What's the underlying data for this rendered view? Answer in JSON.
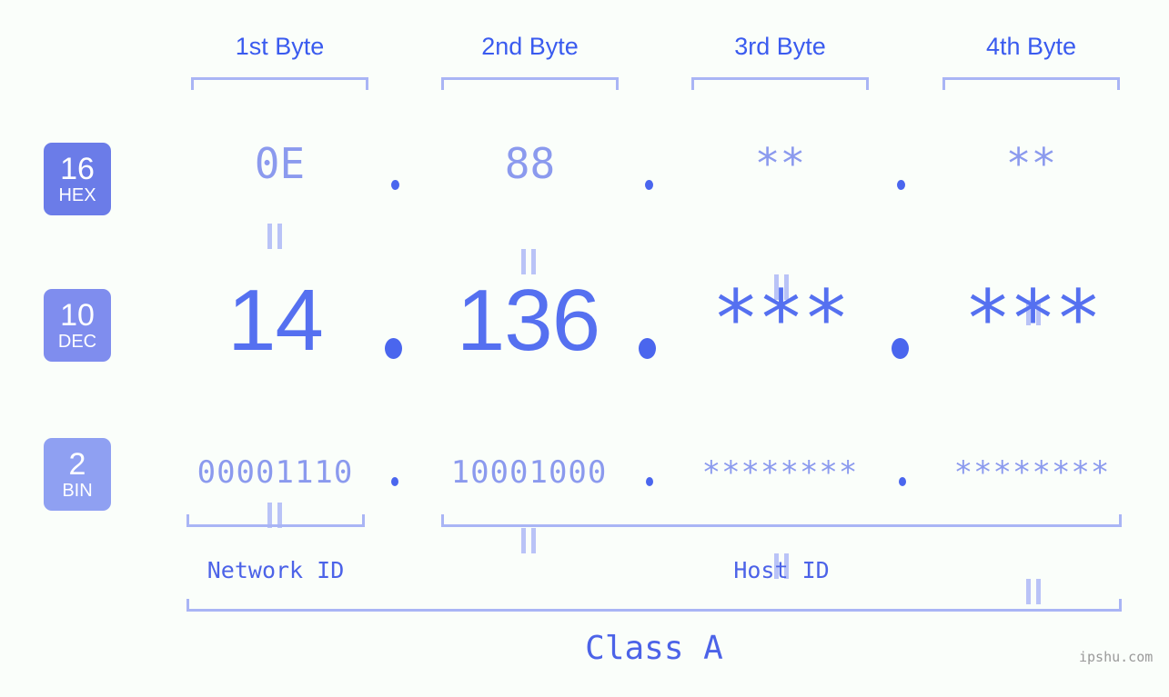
{
  "page": {
    "background": "#FAFEFA",
    "watermark": "ipshu.com"
  },
  "colors": {
    "header_label": "#3A5BEF",
    "bracket": "#A9B5F5",
    "badge_hex": "#6B7CE8",
    "badge_dec": "#7F8DEE",
    "badge_bin": "#8FA0F2",
    "light_value": "#8B9AEE",
    "dec_value": "#5570F0",
    "dot": "#4A66EE",
    "id_label": "#4C63E8",
    "watermark": "#9A9A9A"
  },
  "byte_headers": [
    {
      "label": "1st Byte"
    },
    {
      "label": "2nd Byte"
    },
    {
      "label": "3rd Byte"
    },
    {
      "label": "4th Byte"
    }
  ],
  "rows": [
    {
      "badge": {
        "base": "16",
        "abbr": "HEX"
      },
      "values": [
        "0E",
        "88",
        "**",
        "**"
      ],
      "separator": "."
    },
    {
      "badge": {
        "base": "10",
        "abbr": "DEC"
      },
      "values": [
        "14",
        "136",
        "***",
        "***"
      ],
      "separator": "."
    },
    {
      "badge": {
        "base": "2",
        "abbr": "BIN"
      },
      "values": [
        "00001110",
        "10001000",
        "********",
        "********"
      ],
      "separator": "."
    }
  ],
  "equality_symbol": "=",
  "id_groups": [
    {
      "label": "Network ID"
    },
    {
      "label": "Host ID"
    }
  ],
  "class": {
    "label": "Class A"
  }
}
